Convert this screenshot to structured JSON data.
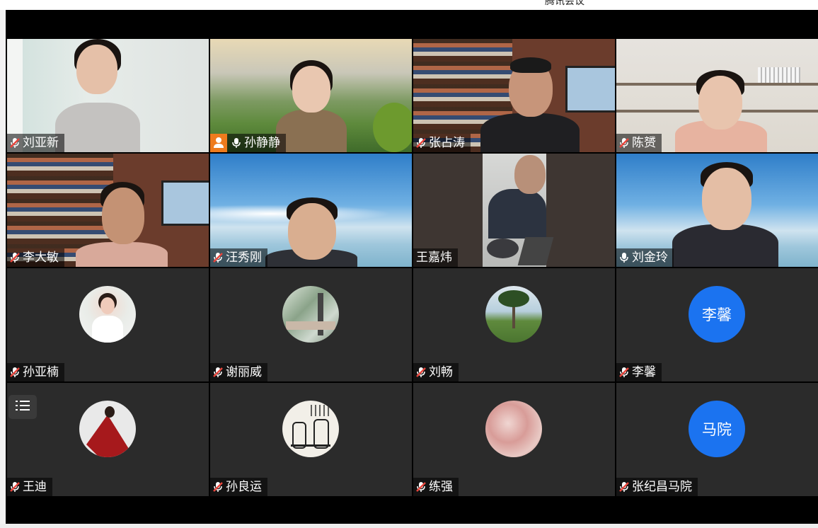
{
  "window": {
    "title": "腾讯会议"
  },
  "icons": {
    "mic_muted": "mic-muted-icon",
    "mic_on": "mic-on-icon",
    "host": "host-icon",
    "participants_list": "list-icon"
  },
  "colors": {
    "avatar_blue": "#1b73f0",
    "muted_red": "#e8453c",
    "host_orange": "#ee7b1d",
    "tile_bg": "#2b2b2b"
  },
  "participants": [
    {
      "name": "刘亚新",
      "mic": "muted"
    },
    {
      "name": "孙静静",
      "mic": "on",
      "host": true
    },
    {
      "name": "张占涛",
      "mic": "muted"
    },
    {
      "name": "陈赟",
      "mic": "muted"
    },
    {
      "name": "李大敏",
      "mic": "muted"
    },
    {
      "name": "汪秀刚",
      "mic": "muted"
    },
    {
      "name": "王嘉炜",
      "mic": "none"
    },
    {
      "name": "刘金玲",
      "mic": "on"
    },
    {
      "name": "孙亚楠",
      "mic": "muted"
    },
    {
      "name": "谢丽威",
      "mic": "muted"
    },
    {
      "name": "刘畅",
      "mic": "muted"
    },
    {
      "name": "李馨",
      "mic": "muted",
      "avatar_text": "李馨"
    },
    {
      "name": "王迪",
      "mic": "muted"
    },
    {
      "name": "孙良运",
      "mic": "muted"
    },
    {
      "name": "练强",
      "mic": "muted"
    },
    {
      "name": "张纪昌马院",
      "mic": "muted",
      "avatar_text": "马院"
    }
  ]
}
